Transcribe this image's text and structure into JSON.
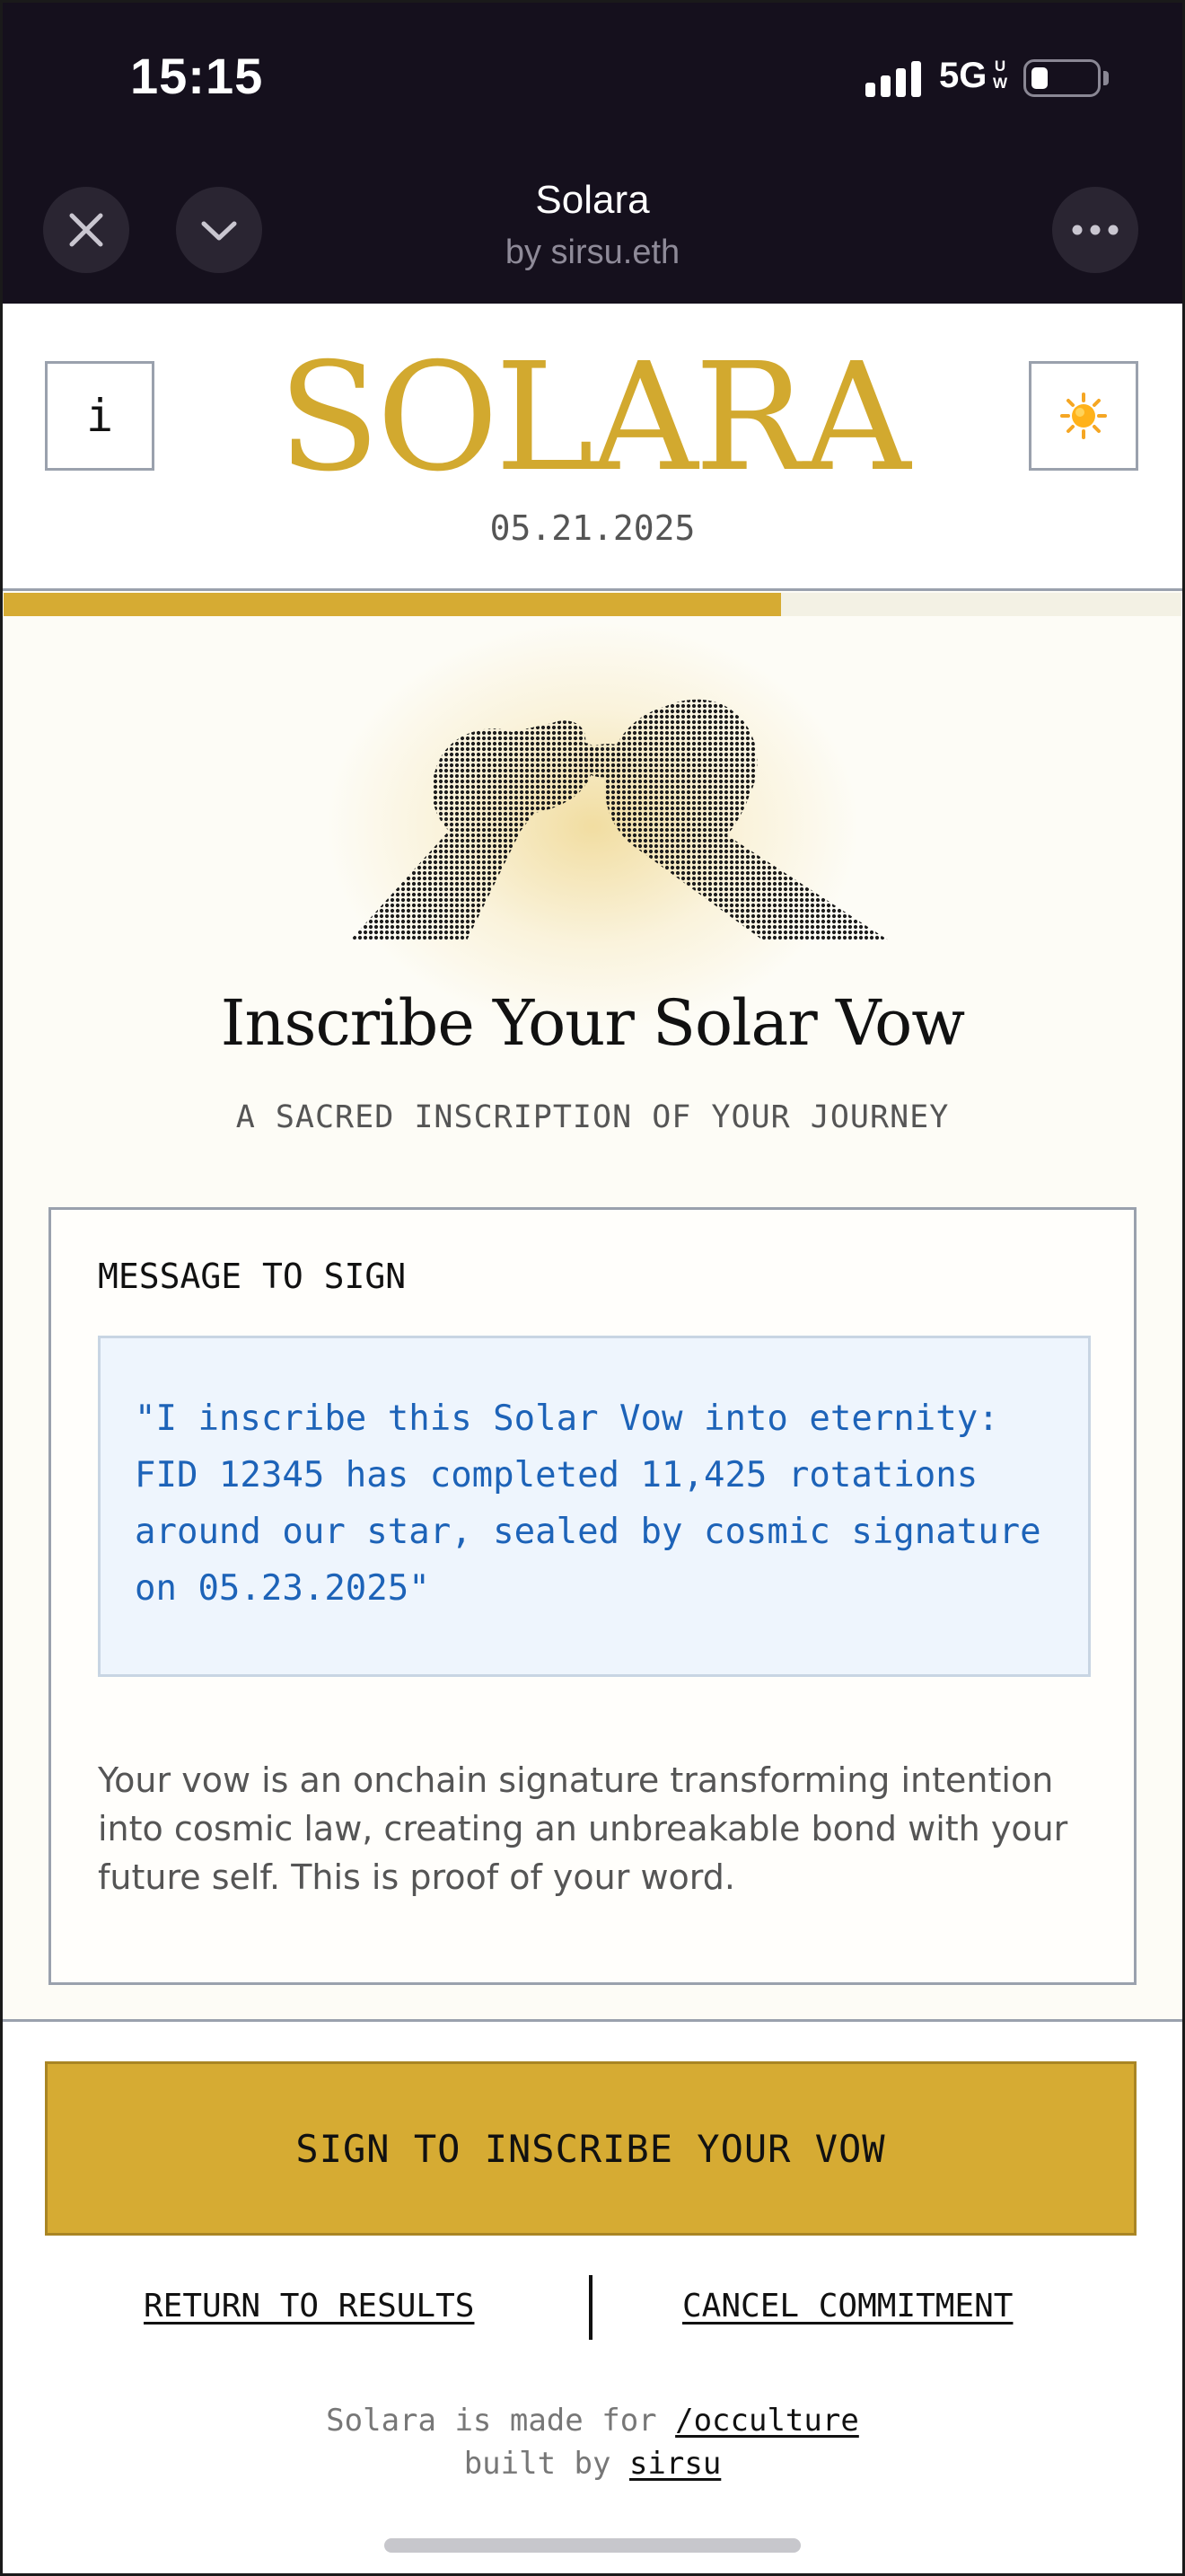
{
  "status_bar": {
    "time": "15:15",
    "network": "5G",
    "network_sup_top": "U",
    "network_sup_bottom": "W",
    "battery_level": 0.2
  },
  "app_header": {
    "title": "Solara",
    "subtitle": "by sirsu.eth",
    "close_icon": "close-icon",
    "collapse_icon": "chevron-down-icon",
    "more_icon": "more-icon"
  },
  "solara_header": {
    "info_label": "i",
    "brand": "SOLARA",
    "date": "05.21.2025",
    "theme_icon": "☀️"
  },
  "progress": {
    "value": 0.66,
    "color": "#d6ab33"
  },
  "main": {
    "illustration": "pinky-promise-hands",
    "headline": "Inscribe Your Solar Vow",
    "subline": "A SACRED INSCRIPTION OF YOUR JOURNEY",
    "card": {
      "label": "MESSAGE TO SIGN",
      "message": "\"I inscribe this Solar Vow into eternity: FID 12345 has completed 11,425 rotations around our star, sealed by cosmic signature on 05.23.2025\"",
      "explain": "Your vow is an onchain signature transforming intention into cosmic law, creating an unbreakable bond with your future self. This is proof of your word."
    }
  },
  "footer": {
    "cta_label": "SIGN TO INSCRIBE YOUR VOW",
    "return_label": "RETURN TO RESULTS",
    "cancel_label": "CANCEL COMMITMENT",
    "credit_line1_prefix": "Solara is made for ",
    "credit_line1_link": "/occulture",
    "credit_line2_prefix": "built by ",
    "credit_line2_link": "sirsu"
  },
  "colors": {
    "accent": "#d6ab33",
    "header_bg": "#15101d",
    "message_text": "#1d63b8"
  }
}
